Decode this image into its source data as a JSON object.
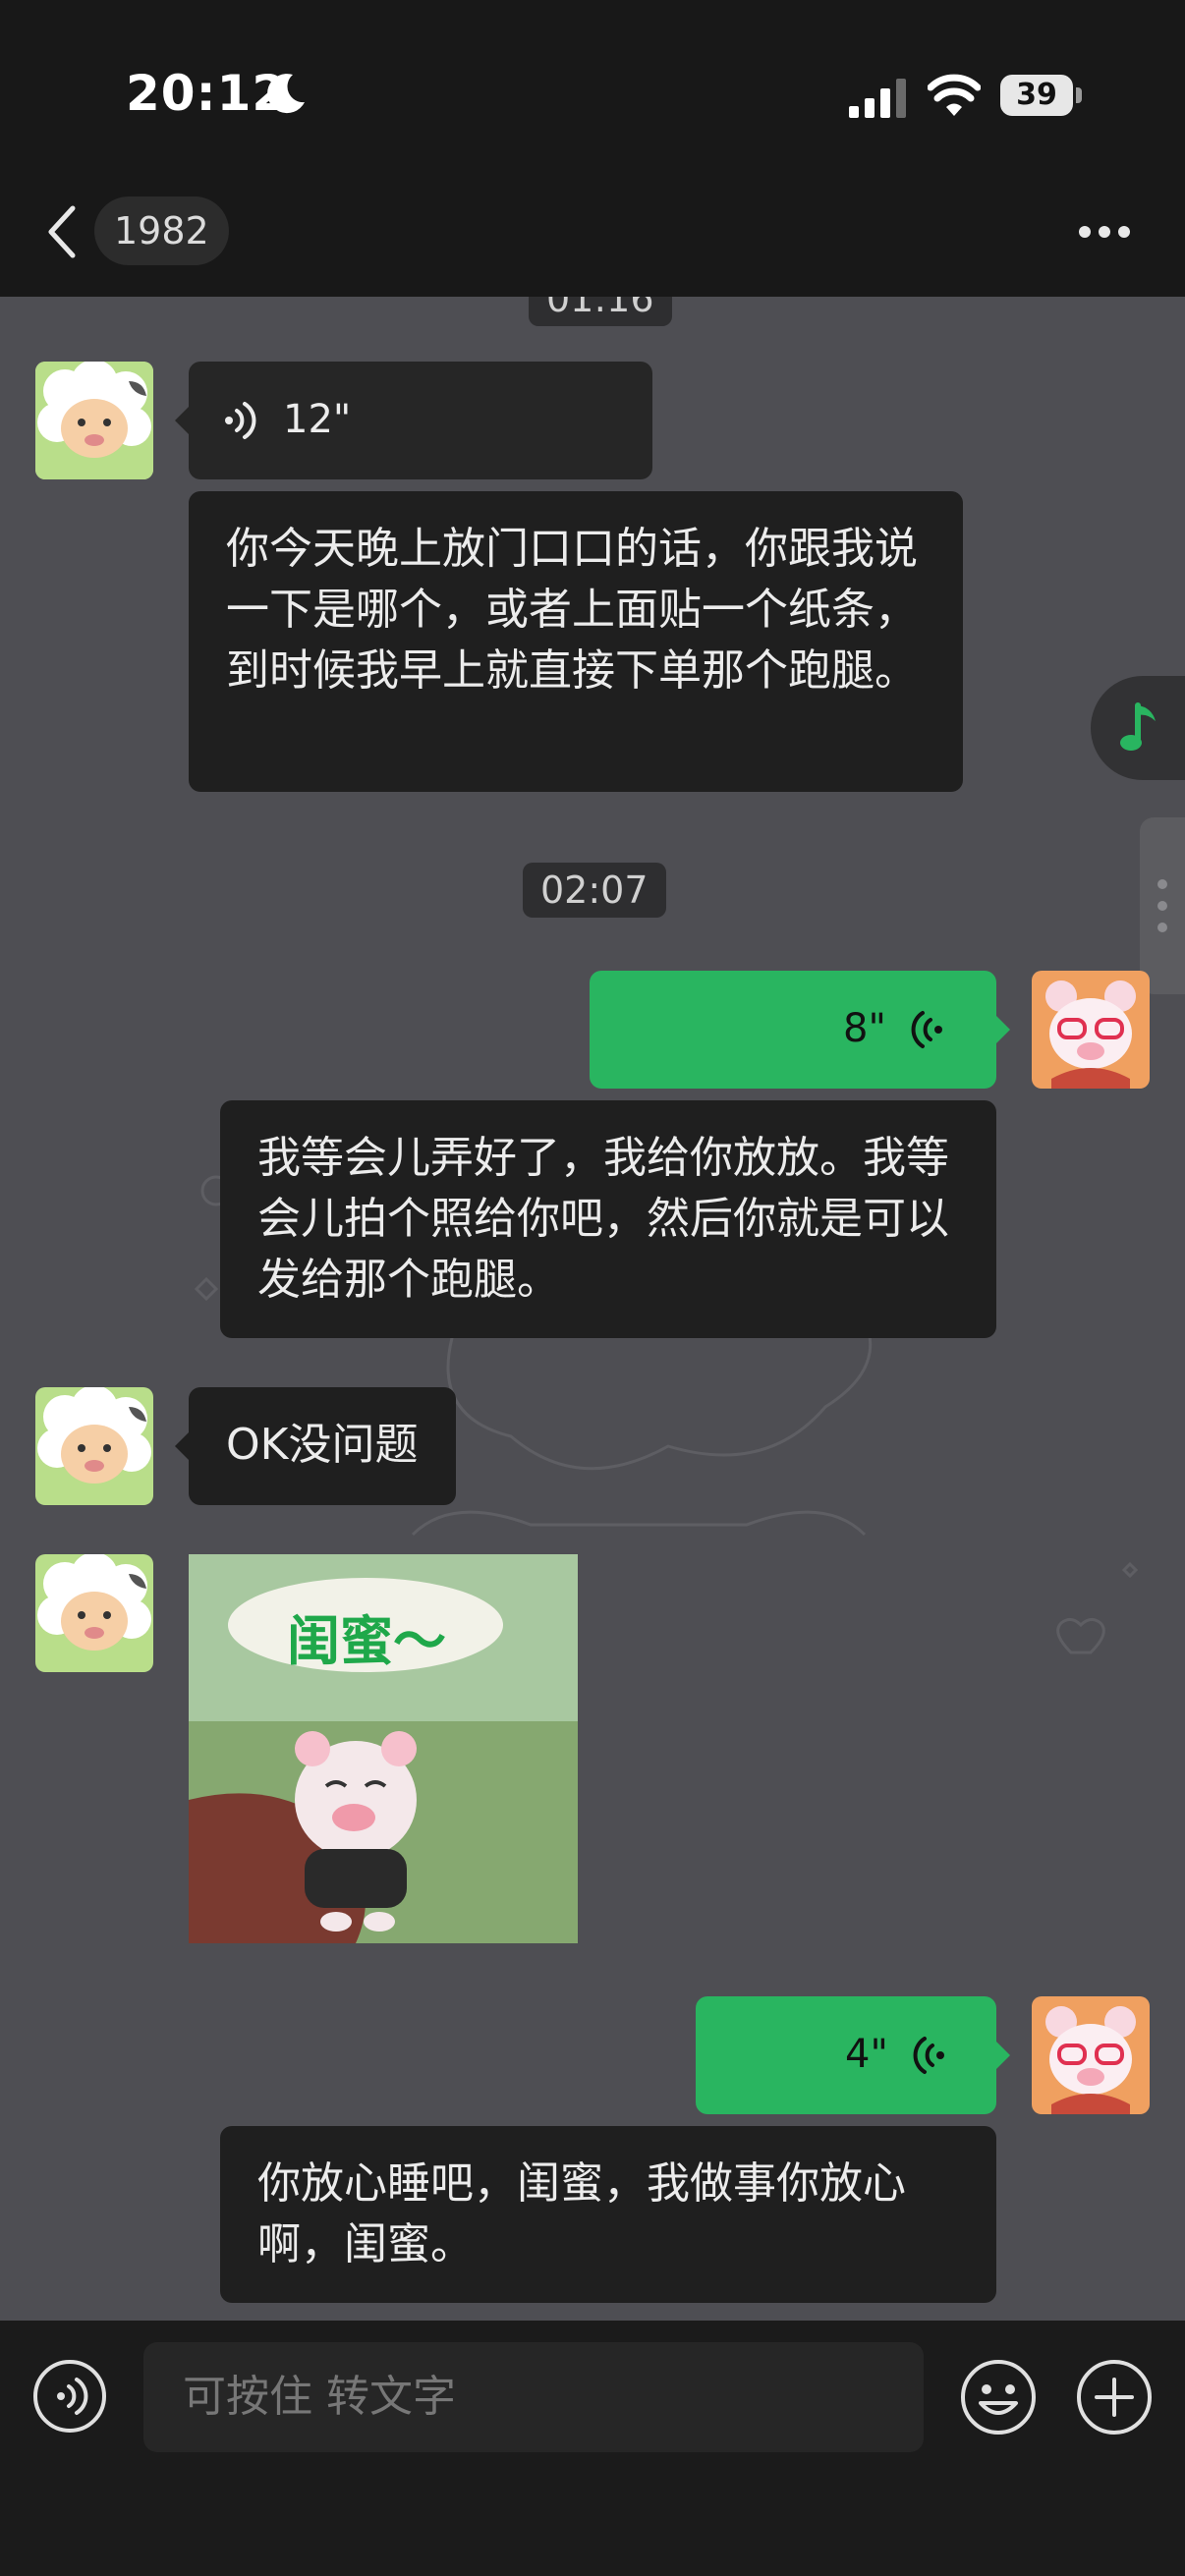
{
  "status_bar": {
    "time": "20:12",
    "battery": "39"
  },
  "nav": {
    "unread_count": "1982",
    "title": "",
    "more_icon": "more-horizontal-icon"
  },
  "messages": {
    "top_time_partial": "01:16",
    "m1_voice_duration": "12\"",
    "m1_transcript": "你今天晚上放门口口的话，你跟我说一下是哪个，或者上面贴一个纸条，到时候我早上就直接下单那个跑腿。",
    "time_label": "02:07",
    "m2_voice_duration": "8\"",
    "m2_transcript": "我等会儿弄好了，我给你放放。我等会儿拍个照给你吧，然后你就是可以发给那个跑腿。",
    "m3_text": "OK没问题",
    "m4_sticker_text": "闺蜜～",
    "m5_voice_duration": "4\"",
    "m5_transcript": "你放心睡吧，闺蜜，我做事你放心啊，闺蜜。"
  },
  "input_bar": {
    "placeholder": "可按住 转文字"
  },
  "colors": {
    "accent_green": "#29b560",
    "chat_bg": "#4e4e53",
    "bubble_dark": "#1f1f1f"
  }
}
